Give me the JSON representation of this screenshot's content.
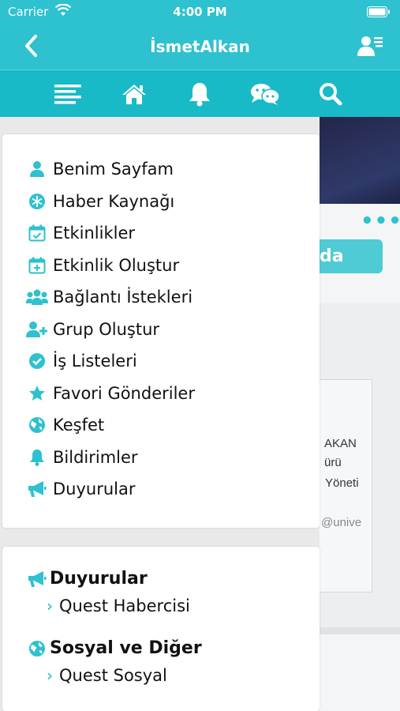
{
  "status_bar": {
    "carrier": "Carrier",
    "time": "4:00 PM"
  },
  "nav": {
    "title": "İsmetAlkan",
    "back_icon": "chevron-left-icon",
    "profile_icon": "profile-list-icon"
  },
  "tabs": [
    {
      "icon": "menu-lines-icon"
    },
    {
      "icon": "home-icon"
    },
    {
      "icon": "bell-icon"
    },
    {
      "icon": "chat-bubbles-icon"
    },
    {
      "icon": "search-icon"
    }
  ],
  "menu": [
    {
      "label": "Benim Sayfam",
      "icon": "user-icon"
    },
    {
      "label": "Haber Kaynağı",
      "icon": "snowflake-icon"
    },
    {
      "label": "Etkinlikler",
      "icon": "calendar-check-icon"
    },
    {
      "label": "Etkinlik Oluştur",
      "icon": "calendar-plus-icon"
    },
    {
      "label": "Bağlantı İstekleri",
      "icon": "users-icon"
    },
    {
      "label": "Grup Oluştur",
      "icon": "user-plus-icon"
    },
    {
      "label": "İş Listeleri",
      "icon": "check-circle-icon"
    },
    {
      "label": "Favori Gönderiler",
      "icon": "star-icon"
    },
    {
      "label": "Keşfet",
      "icon": "globe-icon"
    },
    {
      "label": "Bildirimler",
      "icon": "bell-icon"
    },
    {
      "label": "Duyurular",
      "icon": "megaphone-icon"
    }
  ],
  "sections": [
    {
      "title": "Duyurular",
      "icon": "megaphone-icon",
      "link": "Quest Habercisi"
    },
    {
      "title": "Sosyal ve Diğer",
      "icon": "globe-icon",
      "link": "Quest Sosyal"
    }
  ],
  "background": {
    "button_text": "da",
    "lines": [
      "AKAN",
      "ürü",
      "Yöneti",
      "@unive"
    ]
  },
  "colors": {
    "accent": "#2ec1cf",
    "accent_dark": "#18bac7"
  }
}
